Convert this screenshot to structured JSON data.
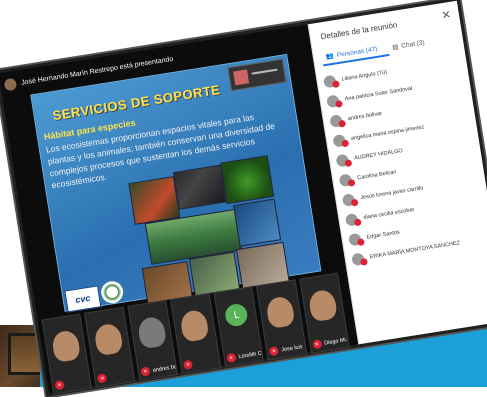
{
  "presenter": {
    "text": "José Hernando Marín Restrepo está presentando"
  },
  "slide": {
    "title": "SERVICIOS DE SOPORTE",
    "subtitle": "Hábitat para especies",
    "body": "Los ecosistemas proporcionan espacios vitales para las plantas y los animales; también conservan una diversidad de complejos procesos que sustentan los demás servicios ecosistémicos.",
    "logo_text": "cvc"
  },
  "participants": [
    {
      "name": "",
      "type": "face"
    },
    {
      "name": "",
      "type": "face"
    },
    {
      "name": "andres bolivar",
      "type": "gray"
    },
    {
      "name": "",
      "type": "face"
    },
    {
      "name": "Lorelith Cárdenas",
      "type": "letter",
      "letter": "L"
    },
    {
      "name": "Jose luis",
      "type": "face"
    },
    {
      "name": "Diego Mi...",
      "type": "face"
    }
  ],
  "sidebar": {
    "title": "Detalles de la reunión",
    "close_icon": "close-icon",
    "tabs": [
      {
        "label": "Personas (47)",
        "icon": "people-icon",
        "active": true
      },
      {
        "label": "Chat (3)",
        "icon": "chat-icon",
        "active": false
      }
    ],
    "people": [
      "Liliana Angulo (Tú)",
      "Ana patricia Suter Sandoval",
      "andres bolivar",
      "angelica maria ospina jimenez",
      "AUDREY HIDALGO",
      "Carolina Beltran",
      "Jesús lorena javier carrillo",
      "diana cecilia escobar",
      "Edgar Santos",
      "ERIKA MARÍA MONTOYA SÁNCHEZ"
    ]
  },
  "colors": {
    "slide_bg": "#2a6fb0",
    "slide_title": "#ffe04a",
    "accent_band": "#1ba1d8",
    "tab_active": "#1a73e8",
    "mic_off": "#dd2233"
  }
}
